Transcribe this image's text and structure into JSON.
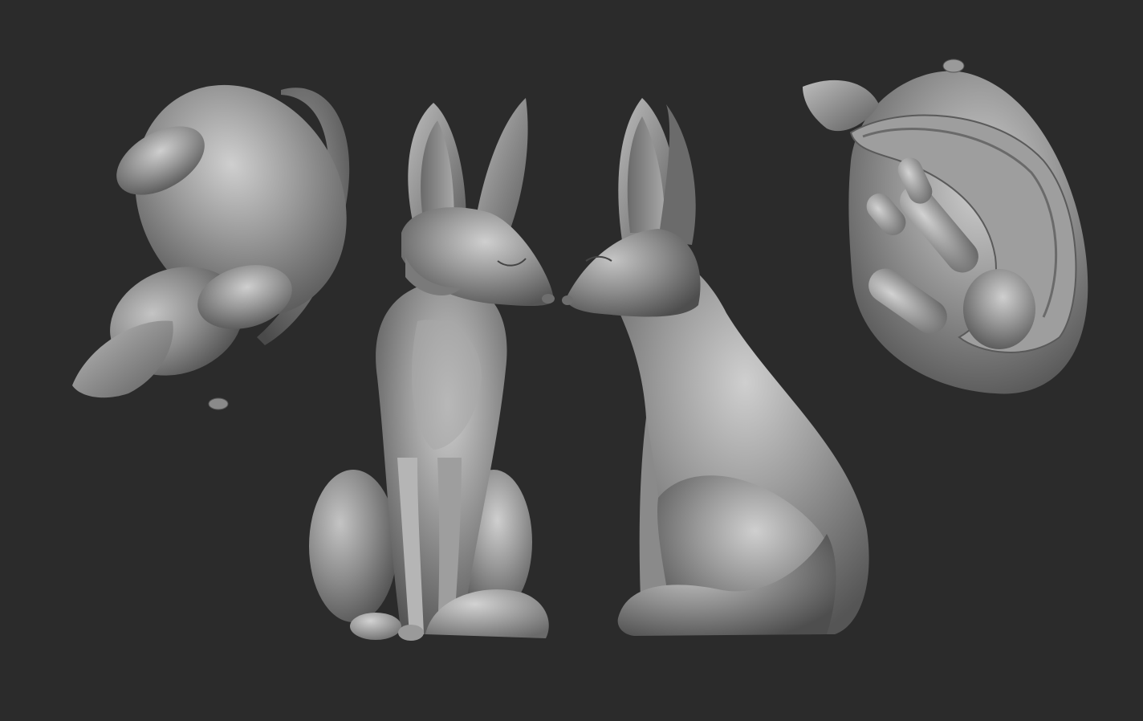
{
  "scene": {
    "background_color": "#2b2b2b",
    "material_base_color": "#8e8e8e",
    "material_highlight_color": "#c9c9c9",
    "material_shadow_color": "#4a4a4a",
    "views": [
      {
        "name": "top-view",
        "subject": "fox-sculpt"
      },
      {
        "name": "front-view",
        "subject": "fox-sculpt"
      },
      {
        "name": "side-view",
        "subject": "fox-sculpt"
      },
      {
        "name": "bottom-view",
        "subject": "fox-sculpt"
      }
    ]
  }
}
